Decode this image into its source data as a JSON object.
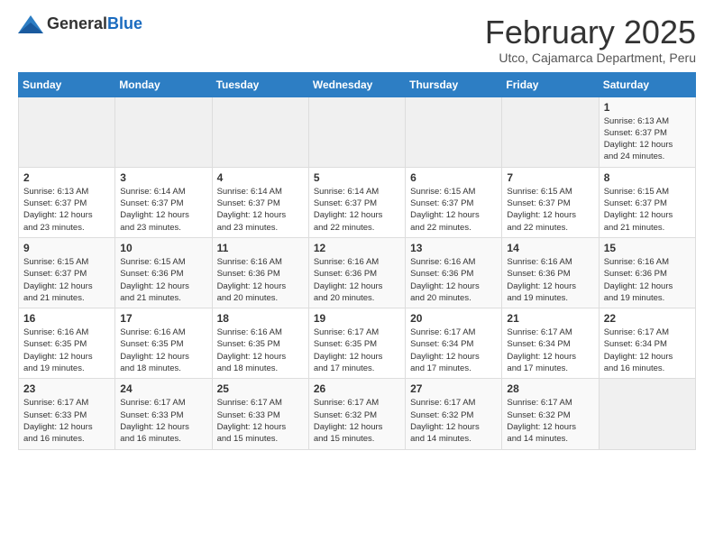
{
  "logo": {
    "text_general": "General",
    "text_blue": "Blue"
  },
  "title": "February 2025",
  "subtitle": "Utco, Cajamarca Department, Peru",
  "weekdays": [
    "Sunday",
    "Monday",
    "Tuesday",
    "Wednesday",
    "Thursday",
    "Friday",
    "Saturday"
  ],
  "weeks": [
    [
      {
        "day": "",
        "info": ""
      },
      {
        "day": "",
        "info": ""
      },
      {
        "day": "",
        "info": ""
      },
      {
        "day": "",
        "info": ""
      },
      {
        "day": "",
        "info": ""
      },
      {
        "day": "",
        "info": ""
      },
      {
        "day": "1",
        "info": "Sunrise: 6:13 AM\nSunset: 6:37 PM\nDaylight: 12 hours\nand 24 minutes."
      }
    ],
    [
      {
        "day": "2",
        "info": "Sunrise: 6:13 AM\nSunset: 6:37 PM\nDaylight: 12 hours\nand 23 minutes."
      },
      {
        "day": "3",
        "info": "Sunrise: 6:14 AM\nSunset: 6:37 PM\nDaylight: 12 hours\nand 23 minutes."
      },
      {
        "day": "4",
        "info": "Sunrise: 6:14 AM\nSunset: 6:37 PM\nDaylight: 12 hours\nand 23 minutes."
      },
      {
        "day": "5",
        "info": "Sunrise: 6:14 AM\nSunset: 6:37 PM\nDaylight: 12 hours\nand 22 minutes."
      },
      {
        "day": "6",
        "info": "Sunrise: 6:15 AM\nSunset: 6:37 PM\nDaylight: 12 hours\nand 22 minutes."
      },
      {
        "day": "7",
        "info": "Sunrise: 6:15 AM\nSunset: 6:37 PM\nDaylight: 12 hours\nand 22 minutes."
      },
      {
        "day": "8",
        "info": "Sunrise: 6:15 AM\nSunset: 6:37 PM\nDaylight: 12 hours\nand 21 minutes."
      }
    ],
    [
      {
        "day": "9",
        "info": "Sunrise: 6:15 AM\nSunset: 6:37 PM\nDaylight: 12 hours\nand 21 minutes."
      },
      {
        "day": "10",
        "info": "Sunrise: 6:15 AM\nSunset: 6:36 PM\nDaylight: 12 hours\nand 21 minutes."
      },
      {
        "day": "11",
        "info": "Sunrise: 6:16 AM\nSunset: 6:36 PM\nDaylight: 12 hours\nand 20 minutes."
      },
      {
        "day": "12",
        "info": "Sunrise: 6:16 AM\nSunset: 6:36 PM\nDaylight: 12 hours\nand 20 minutes."
      },
      {
        "day": "13",
        "info": "Sunrise: 6:16 AM\nSunset: 6:36 PM\nDaylight: 12 hours\nand 20 minutes."
      },
      {
        "day": "14",
        "info": "Sunrise: 6:16 AM\nSunset: 6:36 PM\nDaylight: 12 hours\nand 19 minutes."
      },
      {
        "day": "15",
        "info": "Sunrise: 6:16 AM\nSunset: 6:36 PM\nDaylight: 12 hours\nand 19 minutes."
      }
    ],
    [
      {
        "day": "16",
        "info": "Sunrise: 6:16 AM\nSunset: 6:35 PM\nDaylight: 12 hours\nand 19 minutes."
      },
      {
        "day": "17",
        "info": "Sunrise: 6:16 AM\nSunset: 6:35 PM\nDaylight: 12 hours\nand 18 minutes."
      },
      {
        "day": "18",
        "info": "Sunrise: 6:16 AM\nSunset: 6:35 PM\nDaylight: 12 hours\nand 18 minutes."
      },
      {
        "day": "19",
        "info": "Sunrise: 6:17 AM\nSunset: 6:35 PM\nDaylight: 12 hours\nand 17 minutes."
      },
      {
        "day": "20",
        "info": "Sunrise: 6:17 AM\nSunset: 6:34 PM\nDaylight: 12 hours\nand 17 minutes."
      },
      {
        "day": "21",
        "info": "Sunrise: 6:17 AM\nSunset: 6:34 PM\nDaylight: 12 hours\nand 17 minutes."
      },
      {
        "day": "22",
        "info": "Sunrise: 6:17 AM\nSunset: 6:34 PM\nDaylight: 12 hours\nand 16 minutes."
      }
    ],
    [
      {
        "day": "23",
        "info": "Sunrise: 6:17 AM\nSunset: 6:33 PM\nDaylight: 12 hours\nand 16 minutes."
      },
      {
        "day": "24",
        "info": "Sunrise: 6:17 AM\nSunset: 6:33 PM\nDaylight: 12 hours\nand 16 minutes."
      },
      {
        "day": "25",
        "info": "Sunrise: 6:17 AM\nSunset: 6:33 PM\nDaylight: 12 hours\nand 15 minutes."
      },
      {
        "day": "26",
        "info": "Sunrise: 6:17 AM\nSunset: 6:32 PM\nDaylight: 12 hours\nand 15 minutes."
      },
      {
        "day": "27",
        "info": "Sunrise: 6:17 AM\nSunset: 6:32 PM\nDaylight: 12 hours\nand 14 minutes."
      },
      {
        "day": "28",
        "info": "Sunrise: 6:17 AM\nSunset: 6:32 PM\nDaylight: 12 hours\nand 14 minutes."
      },
      {
        "day": "",
        "info": ""
      }
    ]
  ]
}
